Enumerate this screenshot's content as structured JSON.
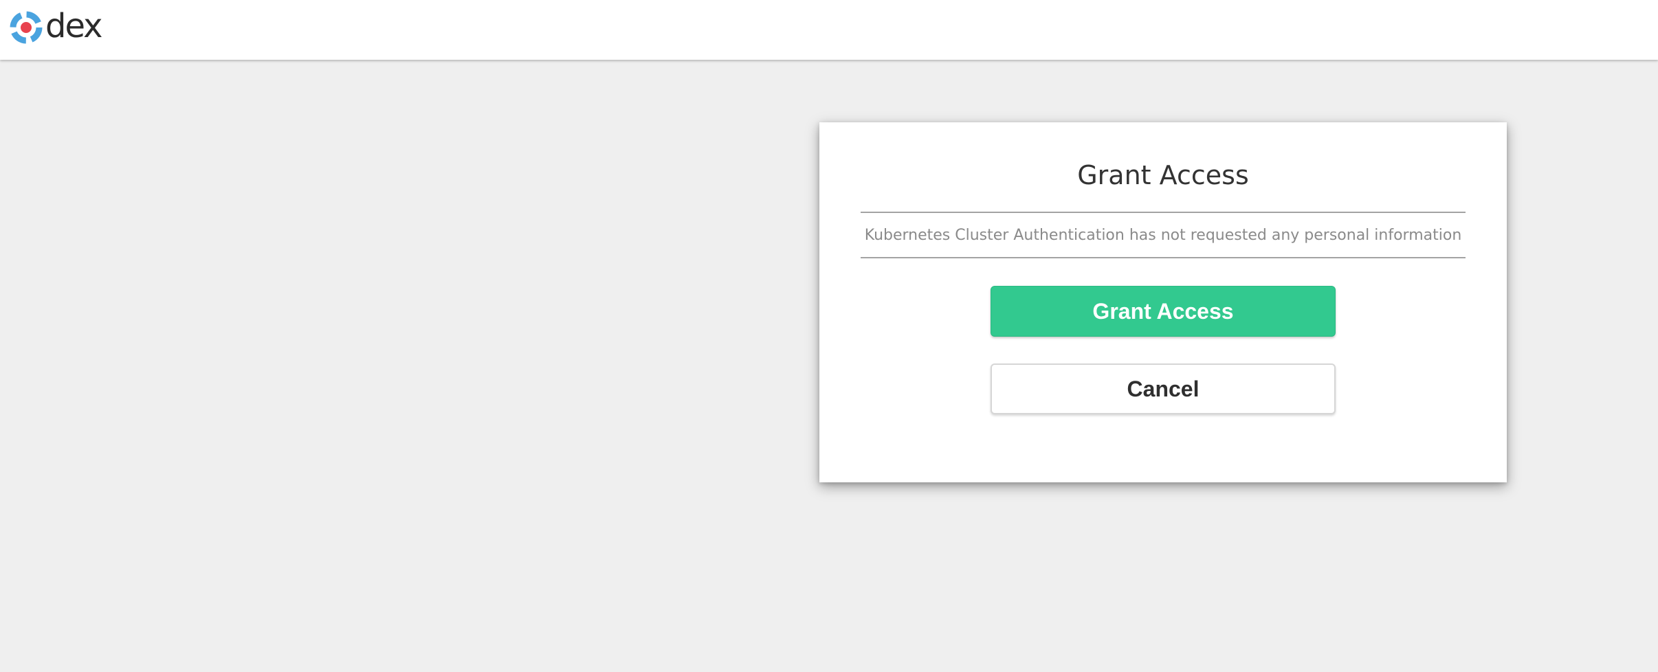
{
  "header": {
    "logo_text": "dex",
    "logo_icon": "dex-logo-icon"
  },
  "dialog": {
    "title": "Grant Access",
    "info_message": "Kubernetes Cluster Authentication has not requested any personal information",
    "grant_label": "Grant Access",
    "cancel_label": "Cancel"
  },
  "colors": {
    "background": "#efefef",
    "grant_button": "#32c98f",
    "logo_blue": "#4aa3df",
    "logo_red": "#e8424e"
  }
}
